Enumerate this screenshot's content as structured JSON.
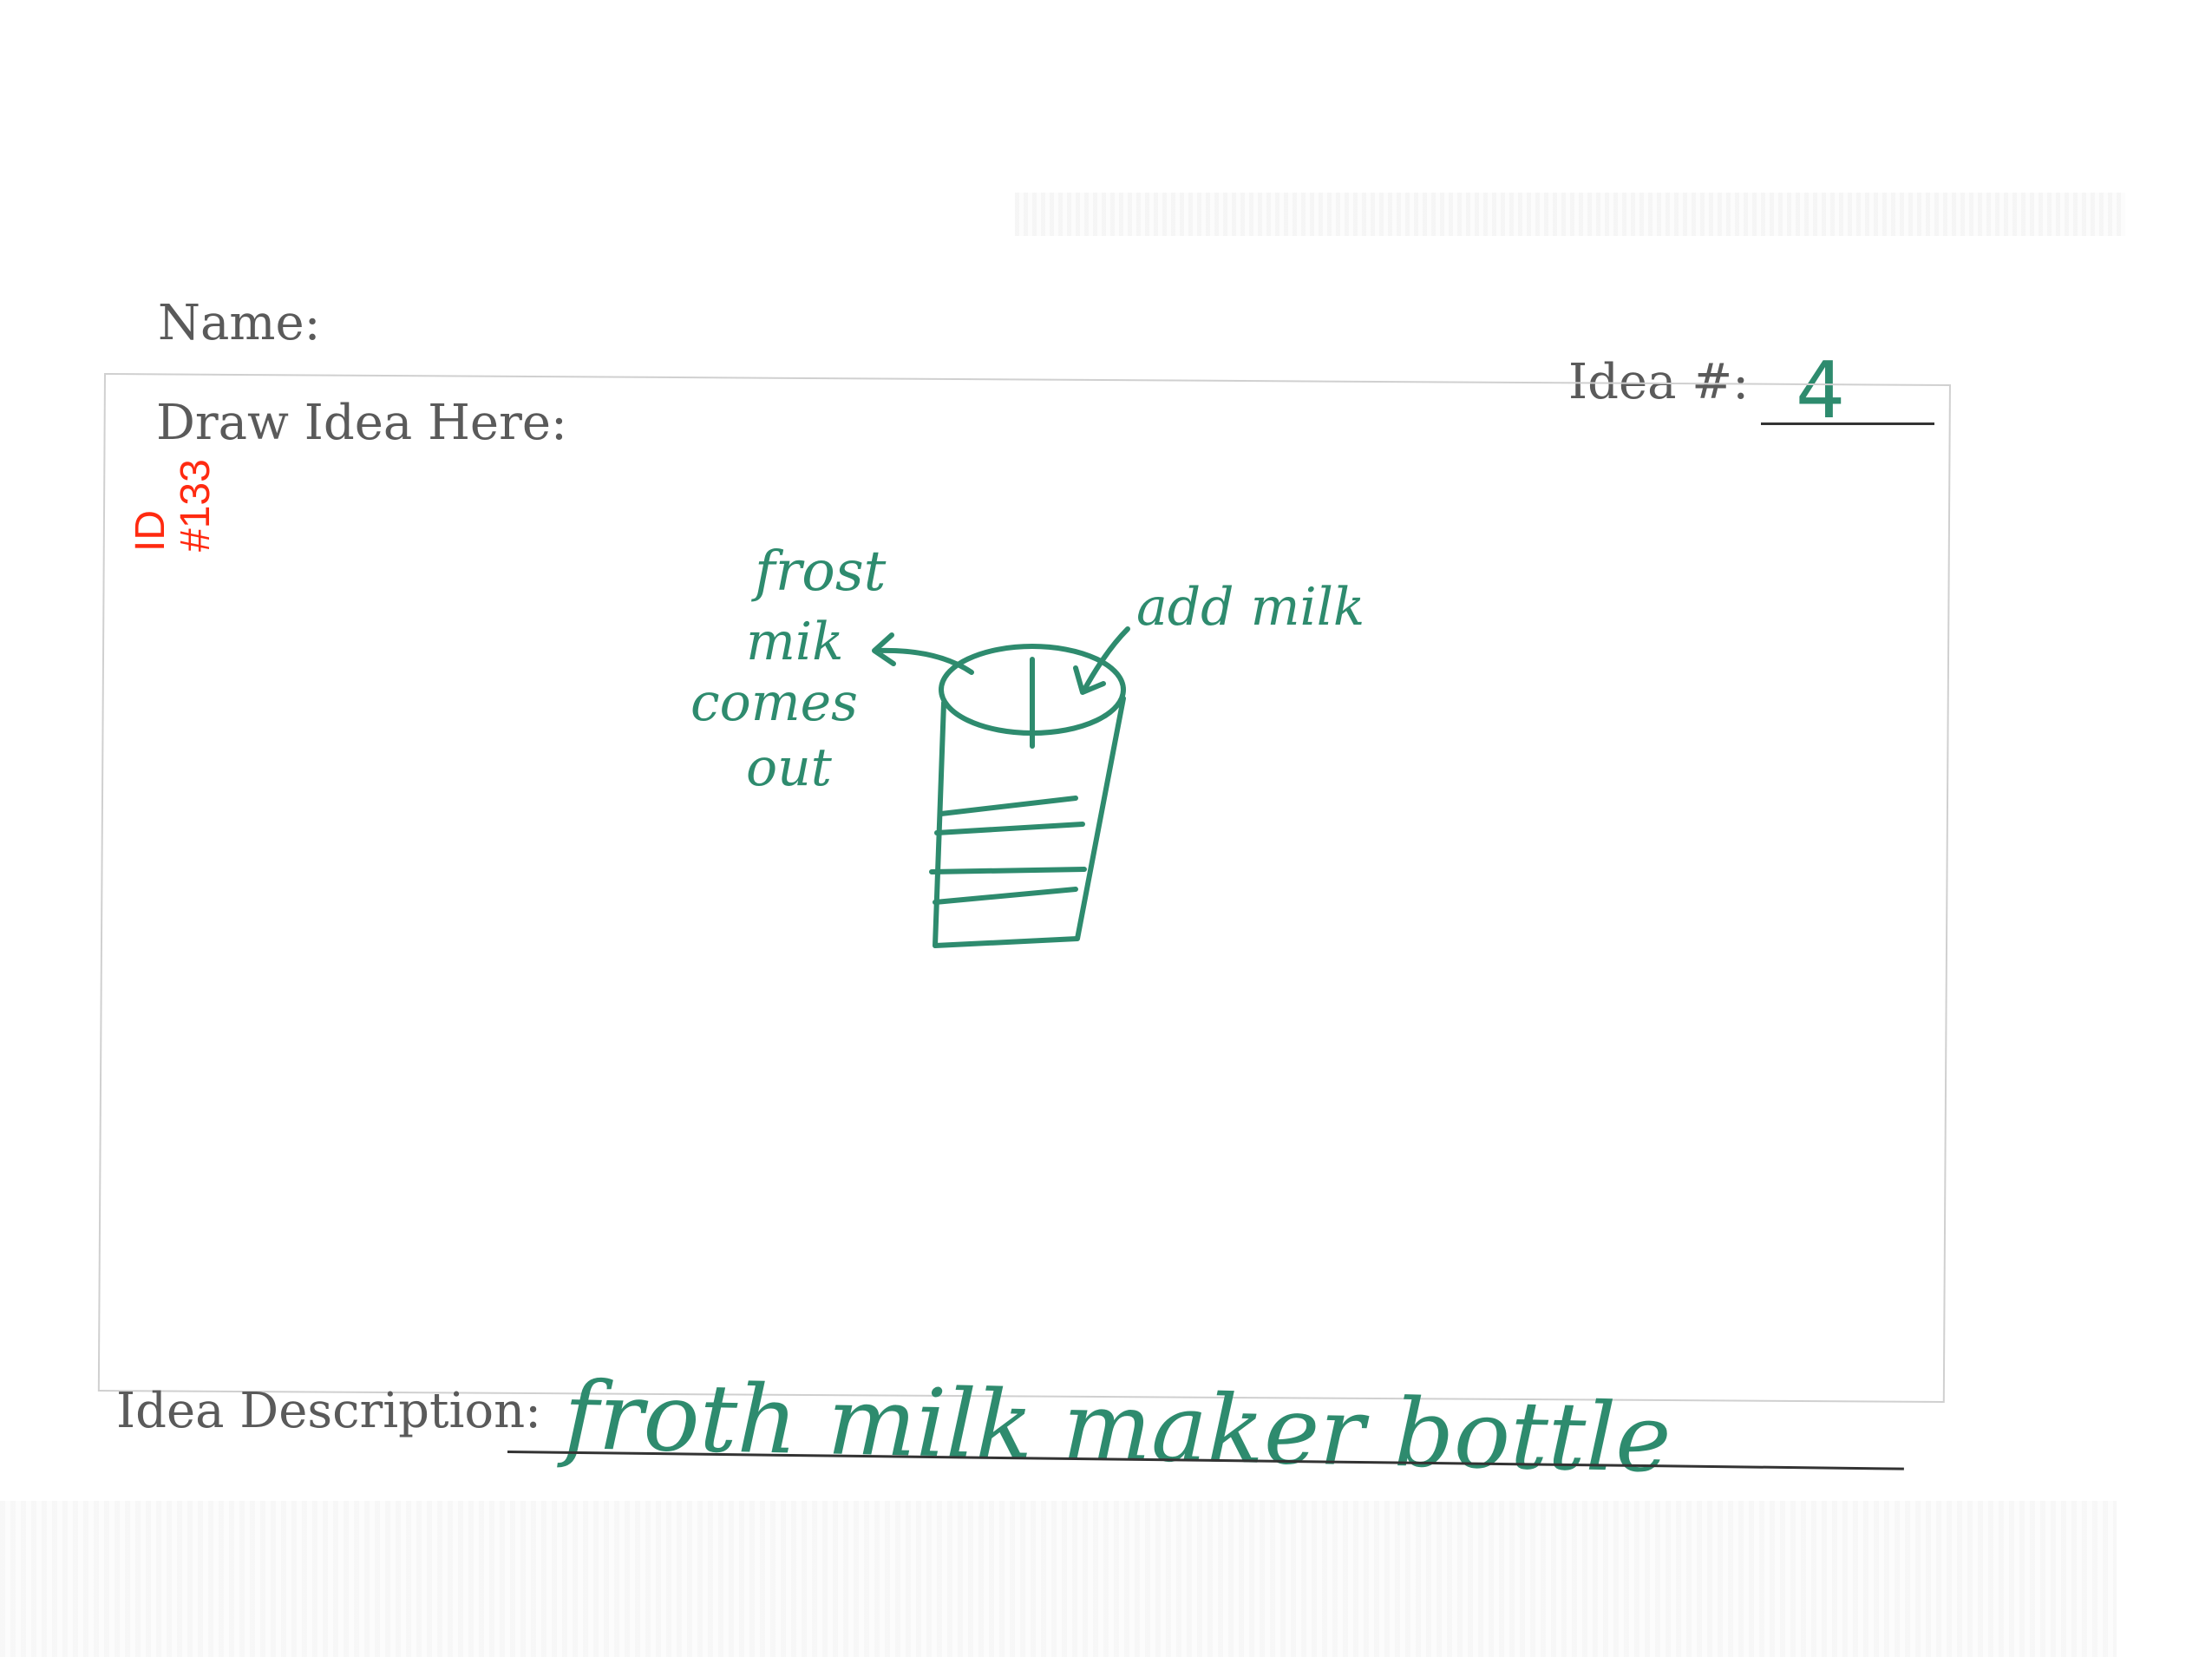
{
  "form": {
    "name_label": "Name:",
    "idea_number_label": "Idea #:",
    "idea_number_value": "4",
    "draw_label": "Draw Idea Here:",
    "description_label": "Idea Description:",
    "description_value": "froth milk maker bottle"
  },
  "id_tag": {
    "line1": "ID",
    "line2": "#133"
  },
  "sketch": {
    "left_annotation": [
      "frost",
      "mik",
      "comes",
      "out"
    ],
    "right_annotation": "add milk",
    "ink_color": "#2e8b6e"
  },
  "colors": {
    "print": "#5a5a5a",
    "ink": "#2e8b6e",
    "id_tag": "#ff2a10"
  }
}
